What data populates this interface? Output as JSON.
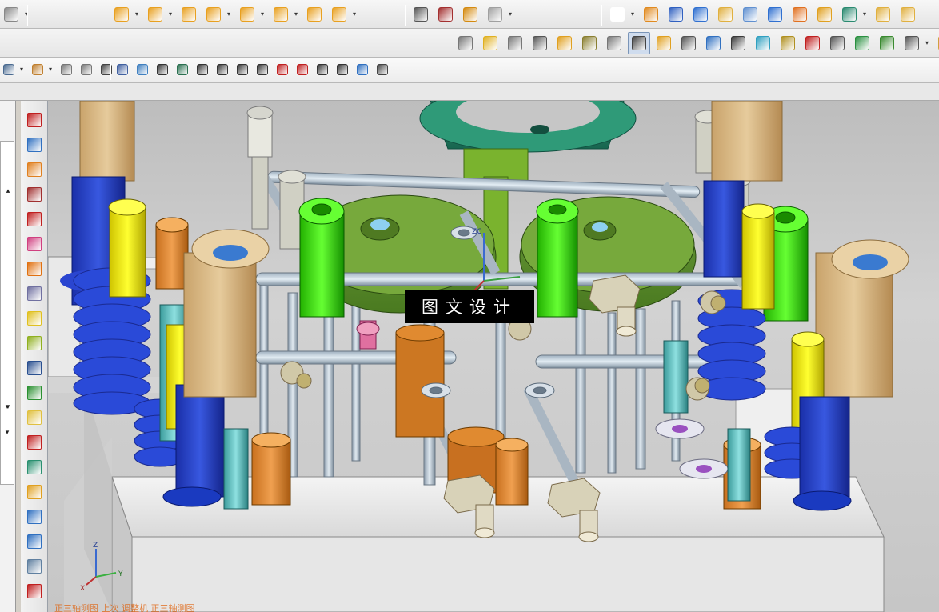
{
  "window": {
    "viewport_overlay_text": "图文设计"
  },
  "status": {
    "hint": "正三轴测图 上次 调整机 正三轴测图"
  },
  "triad": {
    "x_label": "X",
    "y_label": "Y",
    "z_label": "Z"
  },
  "wcs": {
    "label": "ZC"
  },
  "toolbars": {
    "row1_left": [
      {
        "name": "sketch-arrow-icon",
        "dropdown": true
      }
    ],
    "row1_a": [
      {
        "name": "assembly-add-icon",
        "color": "#e8a020",
        "dropdown": true
      },
      {
        "name": "assembly-tri-icon",
        "color": "#e8a020",
        "dropdown": true
      },
      {
        "name": "assembly-x-icon",
        "color": "#e8a020",
        "dropdown": false
      },
      {
        "name": "assembly-copy-icon",
        "color": "#e8a020",
        "dropdown": true
      },
      {
        "name": "assembly-mirror-icon",
        "color": "#e8a020",
        "dropdown": true
      },
      {
        "name": "assembly-move-icon",
        "color": "#e8a020",
        "dropdown": true
      },
      {
        "name": "assembly-pattern-icon",
        "color": "#e8a020",
        "dropdown": false
      },
      {
        "name": "assembly-check-icon",
        "color": "#e8a020",
        "dropdown": true
      }
    ],
    "row1_b": [
      {
        "name": "triangle-icon",
        "color": "#555555",
        "dropdown": false
      },
      {
        "name": "table-icon",
        "color": "#a33030",
        "dropdown": false
      },
      {
        "name": "point-set-icon",
        "color": "#d48a10",
        "dropdown": false
      },
      {
        "name": "gear-group-icon",
        "color": "#a0a0a0",
        "dropdown": true
      }
    ],
    "row1_c": [
      {
        "name": "rectangle-icon",
        "color": "#ffffff",
        "dropdown": true
      },
      {
        "name": "extrude-icon",
        "color": "#e08a20",
        "dropdown": false
      },
      {
        "name": "revolve-icon",
        "color": "#3060c0",
        "dropdown": false
      },
      {
        "name": "block-icon",
        "color": "#3070d0",
        "dropdown": false
      },
      {
        "name": "boolean-icon",
        "color": "#e0b040",
        "dropdown": false
      },
      {
        "name": "blend-icon",
        "color": "#6090d0",
        "dropdown": false
      },
      {
        "name": "hole-icon",
        "color": "#3070d0",
        "dropdown": false
      },
      {
        "name": "pad-icon",
        "color": "#e07020",
        "dropdown": false
      },
      {
        "name": "datum-icon",
        "color": "#e0a020",
        "dropdown": false
      },
      {
        "name": "point-icon",
        "color": "#2a8a70",
        "dropdown": true
      },
      {
        "name": "wedge-icon",
        "color": "#e0b040",
        "dropdown": false
      },
      {
        "name": "edge-icon",
        "color": "#e0b040",
        "dropdown": false
      }
    ],
    "row2": [
      {
        "name": "doc-properties-icon",
        "color": "#777777",
        "dropdown": false
      },
      {
        "name": "paint-icon",
        "color": "#e0b020",
        "dropdown": false
      },
      {
        "name": "grid-frame-icon",
        "color": "#777777",
        "dropdown": false
      },
      {
        "name": "axes-icon",
        "color": "#555555",
        "dropdown": false
      },
      {
        "name": "cube-outline-icon",
        "color": "#e0a020",
        "dropdown": false
      },
      {
        "name": "section-icon",
        "color": "#8a7f30",
        "dropdown": false
      },
      {
        "name": "mold-slot-icon",
        "color": "#777777",
        "dropdown": false
      },
      {
        "name": "tools-icon",
        "color": "#444444",
        "dropdown": false,
        "active": true
      },
      {
        "name": "stack-icon",
        "color": "#e0a020",
        "dropdown": false
      },
      {
        "name": "list-icon",
        "color": "#555555",
        "dropdown": false
      },
      {
        "name": "ejector-icon",
        "color": "#3070c0",
        "dropdown": false
      },
      {
        "name": "slider-icon",
        "color": "#3a3a3a",
        "dropdown": false
      },
      {
        "name": "cooling-icon",
        "color": "#30a0c0",
        "dropdown": false
      },
      {
        "name": "insert-icon",
        "color": "#b09020",
        "dropdown": false
      },
      {
        "name": "electrode-icon",
        "color": "#c02020",
        "dropdown": false
      },
      {
        "name": "frame-icon",
        "color": "#555555",
        "dropdown": false
      },
      {
        "name": "cavity-icon",
        "color": "#2a9040",
        "dropdown": false
      },
      {
        "name": "bom-icon",
        "color": "#3a8a30",
        "dropdown": false
      },
      {
        "name": "pin-icon",
        "color": "#555555",
        "dropdown": true
      },
      {
        "name": "pen-icon",
        "color": "#d0a040",
        "dropdown": false
      }
    ],
    "row3_a": [
      {
        "name": "filter-icon",
        "color": "#4a6a90",
        "dropdown": true
      },
      {
        "name": "select-mode-icon",
        "color": "#c08030",
        "dropdown": true
      },
      {
        "name": "selection-arrow-icon",
        "color": "#777777",
        "dropdown": false
      },
      {
        "name": "pointer-icon",
        "color": "#777777",
        "dropdown": false
      },
      {
        "name": "box-select-icon",
        "color": "#444444",
        "dropdown": true
      }
    ],
    "row3_b": [
      {
        "name": "view-solid-icon",
        "color": "#4060a0",
        "dropdown": false
      },
      {
        "name": "view-shade-icon",
        "color": "#4080c0",
        "dropdown": false
      },
      {
        "name": "snap-end-icon",
        "color": "#333333",
        "dropdown": false
      },
      {
        "name": "snap-mid-icon",
        "color": "#2a7050",
        "dropdown": false
      },
      {
        "name": "line-tool-icon",
        "color": "#333333",
        "dropdown": false
      },
      {
        "name": "line-tool-2-icon",
        "color": "#333333",
        "dropdown": false
      },
      {
        "name": "arc-tool-icon",
        "color": "#333333",
        "dropdown": false
      },
      {
        "name": "intersect-icon",
        "color": "#333333",
        "dropdown": false
      },
      {
        "name": "center-icon",
        "color": "#c02020",
        "dropdown": false
      },
      {
        "name": "circle-icon",
        "color": "#c02020",
        "dropdown": false
      },
      {
        "name": "plus-icon",
        "color": "#333333",
        "dropdown": false
      },
      {
        "name": "diagonal-icon",
        "color": "#333333",
        "dropdown": false
      },
      {
        "name": "tag-icon",
        "color": "#3070c0",
        "dropdown": false
      },
      {
        "name": "grid-icon",
        "color": "#444444",
        "dropdown": false
      }
    ],
    "side": [
      {
        "name": "cube-red-icon",
        "color": "#c02020"
      },
      {
        "name": "assembly-move-side-icon",
        "color": "#3070c0"
      },
      {
        "name": "align-icon",
        "color": "#e08020"
      },
      {
        "name": "box-red-icon",
        "color": "#a03030"
      },
      {
        "name": "cube-solid-icon",
        "color": "#c02020"
      },
      {
        "name": "surface-icon",
        "color": "#d04080"
      },
      {
        "name": "shell-icon",
        "color": "#e07010"
      },
      {
        "name": "layer-icon",
        "color": "#7070a0"
      },
      {
        "name": "layers-icon",
        "color": "#e0c020"
      },
      {
        "name": "curve-icon",
        "color": "#90b020"
      },
      {
        "name": "measure-icon",
        "color": "#2a5090"
      },
      {
        "name": "check-box-icon",
        "color": "#2a9030"
      },
      {
        "name": "cube-yellow-icon",
        "color": "#e0c040"
      },
      {
        "name": "cut-icon",
        "color": "#c02020"
      },
      {
        "name": "draft-icon",
        "color": "#2a9070"
      },
      {
        "name": "wedge-side-icon",
        "color": "#e0a020"
      },
      {
        "name": "parts-icon",
        "color": "#3070c0"
      },
      {
        "name": "swap-icon",
        "color": "#3070c0"
      },
      {
        "name": "browser-icon",
        "color": "#6080a0"
      },
      {
        "name": "crosshair-icon",
        "color": "#c02020"
      }
    ]
  }
}
